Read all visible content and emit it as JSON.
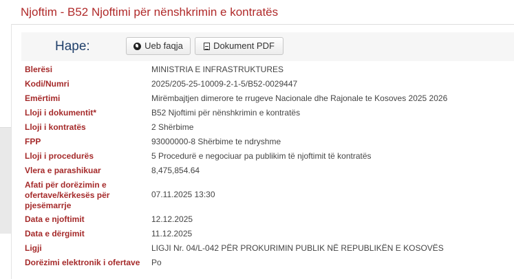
{
  "page": {
    "title": "Njoftim - B52 Njoftimi për nënshkrimin e kontratës"
  },
  "actions": {
    "label": "Hape:",
    "web_button": "Ueb faqja",
    "pdf_button": "Dokument PDF"
  },
  "details": [
    {
      "label": "Blerësi",
      "value": "MINISTRIA E INFRASTRUKTURES"
    },
    {
      "label": "Kodi/Numri",
      "value": "2025/205-25-10009-2-1-5/B52-0029447"
    },
    {
      "label": "Emërtimi",
      "value": "Mirëmbajtjen dimerore te rrugeve Nacionale dhe Rajonale te Kosoves 2025 2026"
    },
    {
      "label": "Lloji i dokumentit*",
      "value": "B52 Njoftimi për nënshkrimin e kontratës"
    },
    {
      "label": "Lloji i kontratës",
      "value": "2 Shërbime"
    },
    {
      "label": "FPP",
      "value": "93000000-8 Shërbime te ndryshme"
    },
    {
      "label": "Lloji i procedurës",
      "value": "5 Procedurë e negociuar pa publikim të njoftimit të kontratës"
    },
    {
      "label": "Vlera e parashikuar",
      "value": "8,475,854.64"
    },
    {
      "label": "Afati për dorëzimin e ofertave/kërkesës për pjesëmarrje",
      "value": "07.11.2025 13:30"
    },
    {
      "label": "Data e njoftimit",
      "value": "12.12.2025"
    },
    {
      "label": "Data e dërgimit",
      "value": "11.12.2025"
    },
    {
      "label": "Ligji",
      "value": "LIGJI Nr. 04/L-042 PËR PROKURIMIN PUBLIK NË REPUBLIKËN E KOSOVËS"
    },
    {
      "label": "Dorëzimi elektronik i ofertave",
      "value": "Po"
    }
  ],
  "colors": {
    "title": "#b02a2a",
    "label": "#a52a2a",
    "hape": "#1f3f6a"
  },
  "icons": {
    "web": "globe-icon",
    "pdf": "pdf-file-icon"
  }
}
